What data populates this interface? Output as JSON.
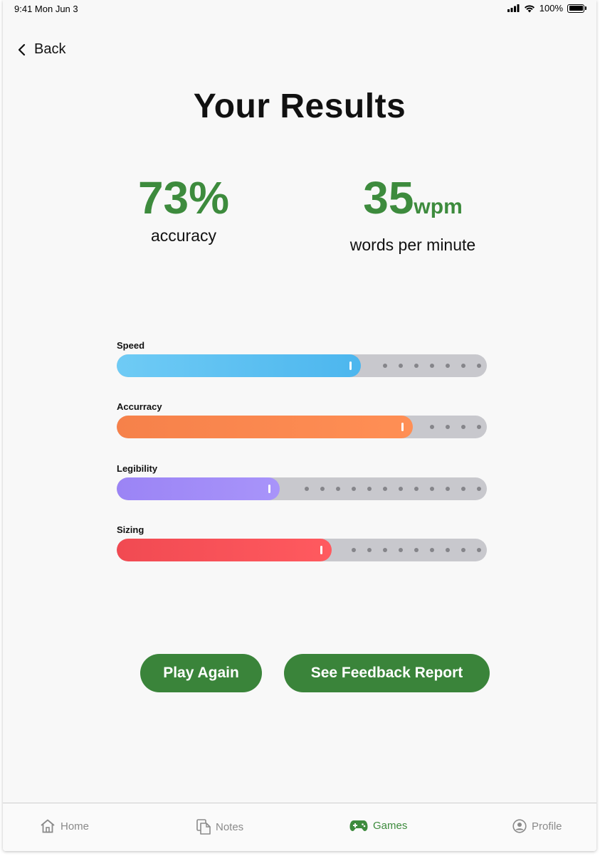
{
  "status_bar": {
    "time": "9:41 Mon Jun 3",
    "battery": "100%"
  },
  "nav": {
    "back_label": "Back"
  },
  "page": {
    "title": "Your Results"
  },
  "stats": {
    "accuracy": {
      "value": "73%",
      "label": "accuracy"
    },
    "wpm": {
      "value": "35",
      "unit": "wpm",
      "label": "words per minute"
    }
  },
  "metrics": [
    {
      "label": "Speed",
      "level": 0.66,
      "color_start": "#6fcbf5",
      "color_end": "#4cb6ee"
    },
    {
      "label": "Accurracy",
      "level": 0.8,
      "color_start": "#f6814a",
      "color_end": "#ff8f55"
    },
    {
      "label": "Legibility",
      "level": 0.44,
      "color_start": "#9b84f5",
      "color_end": "#a894fa"
    },
    {
      "label": "Sizing",
      "level": 0.58,
      "color_start": "#f14a52",
      "color_end": "#ff5a5f"
    }
  ],
  "actions": {
    "play_again": "Play Again",
    "feedback": "See Feedback Report"
  },
  "tabs": [
    {
      "label": "Home",
      "icon": "home-icon"
    },
    {
      "label": "Notes",
      "icon": "notes-icon"
    },
    {
      "label": "Games",
      "icon": "gamepad-icon",
      "active": true
    },
    {
      "label": "Profile",
      "icon": "profile-icon"
    }
  ],
  "colors": {
    "accent": "#3a843a",
    "track": "#c8c8cd",
    "inactive_tab": "#8a8a8a"
  }
}
